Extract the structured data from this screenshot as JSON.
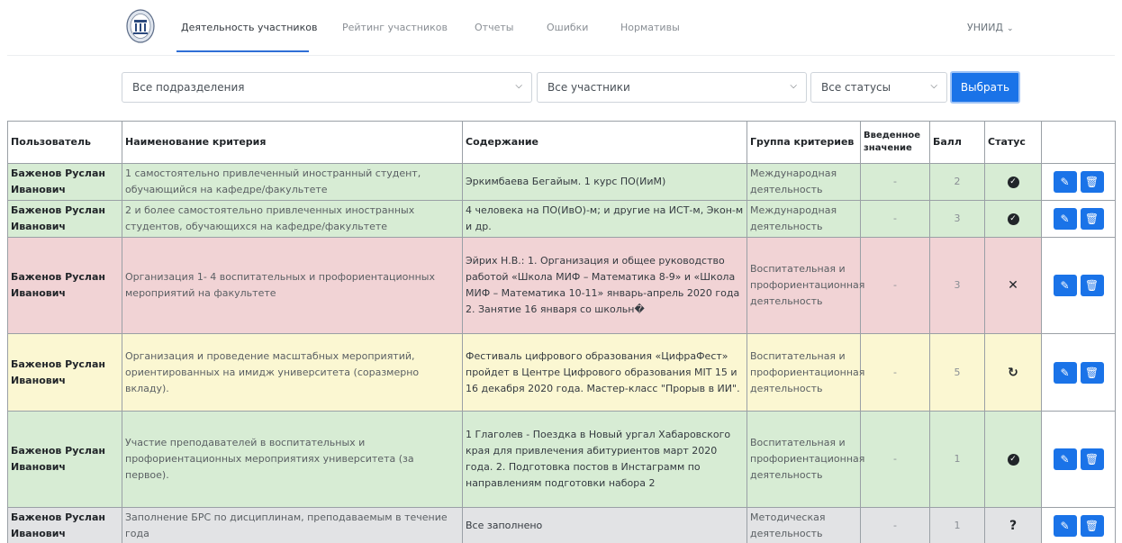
{
  "nav": {
    "items": [
      "Деятельность участников",
      "Рейтинг участников",
      "Отчеты",
      "Ошибки",
      "Нормативы"
    ],
    "user": "УНИИД",
    "accent": "#2f6fd6"
  },
  "filters": {
    "division": "Все подразделения",
    "participants": "Все участники",
    "statuses": "Все статусы",
    "submit": "Выбрать"
  },
  "table": {
    "headers": [
      "Пользователь",
      "Наименование критерия",
      "Содержание",
      "Группа критериев",
      "Введенное значение",
      "Балл",
      "Статус",
      ""
    ],
    "rows": [
      {
        "color": "green",
        "user": "Баженов Руслан Иванович",
        "criterion": "1 самостоятельно привлеченный иностранный студент, обучающийся на кафедре/факультете",
        "content": "Эркимбаева Бегайым. 1 курс ПО(ИиМ)",
        "group": "Международная деятельность",
        "value": "-",
        "score": "2",
        "status": "approved"
      },
      {
        "color": "green",
        "user": "Баженов Руслан Иванович",
        "criterion": "2 и более самостоятельно привлеченных иностранных студентов, обучающихся на кафедре/факультете",
        "content": "4 человека на ПО(ИвО)-м; и другие на ИСТ-м, Экон-м и др.",
        "group": "Международная деятельность",
        "value": "-",
        "score": "3",
        "status": "approved"
      },
      {
        "color": "red",
        "user": "Баженов Руслан Иванович",
        "criterion": "Организация 1- 4 воспитательных и профориентационных мероприятий на факультете",
        "content": "Эйрих Н.В.: 1. Организация и общее руководство работой «Школа МИФ – Математика 8-9» и «Школа МИФ – Математика 10-11» январь-апрель 2020 года 2. Занятие 16 января со школьн�",
        "group": "Воспитательная и профориентационная деятельность",
        "value": "-",
        "score": "3",
        "status": "rejected"
      },
      {
        "color": "yellow",
        "user": "Баженов Руслан Иванович",
        "criterion": "Организация и проведение масштабных мероприятий, ориентированных на имидж университета (соразмерно вкладу).",
        "content": "Фестиваль цифрового образования «ЦифраФест» пройдет в Центре Цифрового образования MIT 15 и 16 декабря 2020 года. Мастер-класс \"Прорыв в ИИ\".",
        "group": "Воспитательная и профориентационная деятельность",
        "value": "-",
        "score": "5",
        "status": "pending"
      },
      {
        "color": "green",
        "user": "Баженов Руслан Иванович",
        "criterion": "Участие преподавателей в воспитательных и профориентационных мероприятиях университета (за первое).",
        "content": "1 Глаголев - Поездка в Новый ургал Хабаровского края для привлечения абитуриентов март 2020 года. 2. Подготовка постов в Инстаграмм по направлениям подготовки набора 2",
        "group": "Воспитательная и профориентационная деятельность",
        "value": "-",
        "score": "1",
        "status": "approved"
      },
      {
        "color": "gray",
        "user": "Баженов Руслан Иванович",
        "criterion": "Заполнение БРС по дисциплинам, преподаваемым в течение года",
        "content": "Все заполнено",
        "group": "Методическая деятельность",
        "value": "-",
        "score": "1",
        "status": "unknown"
      }
    ]
  },
  "status_icons": {
    "approved": "check-circle-icon",
    "rejected": "times-icon",
    "pending": "redo-icon",
    "unknown": "question-icon"
  },
  "colors": {
    "green": "#d7ecd4",
    "red": "#f1d3d5",
    "yellow": "#fbf7d2",
    "gray": "#e2e3e5",
    "button": "#1a73e8"
  }
}
